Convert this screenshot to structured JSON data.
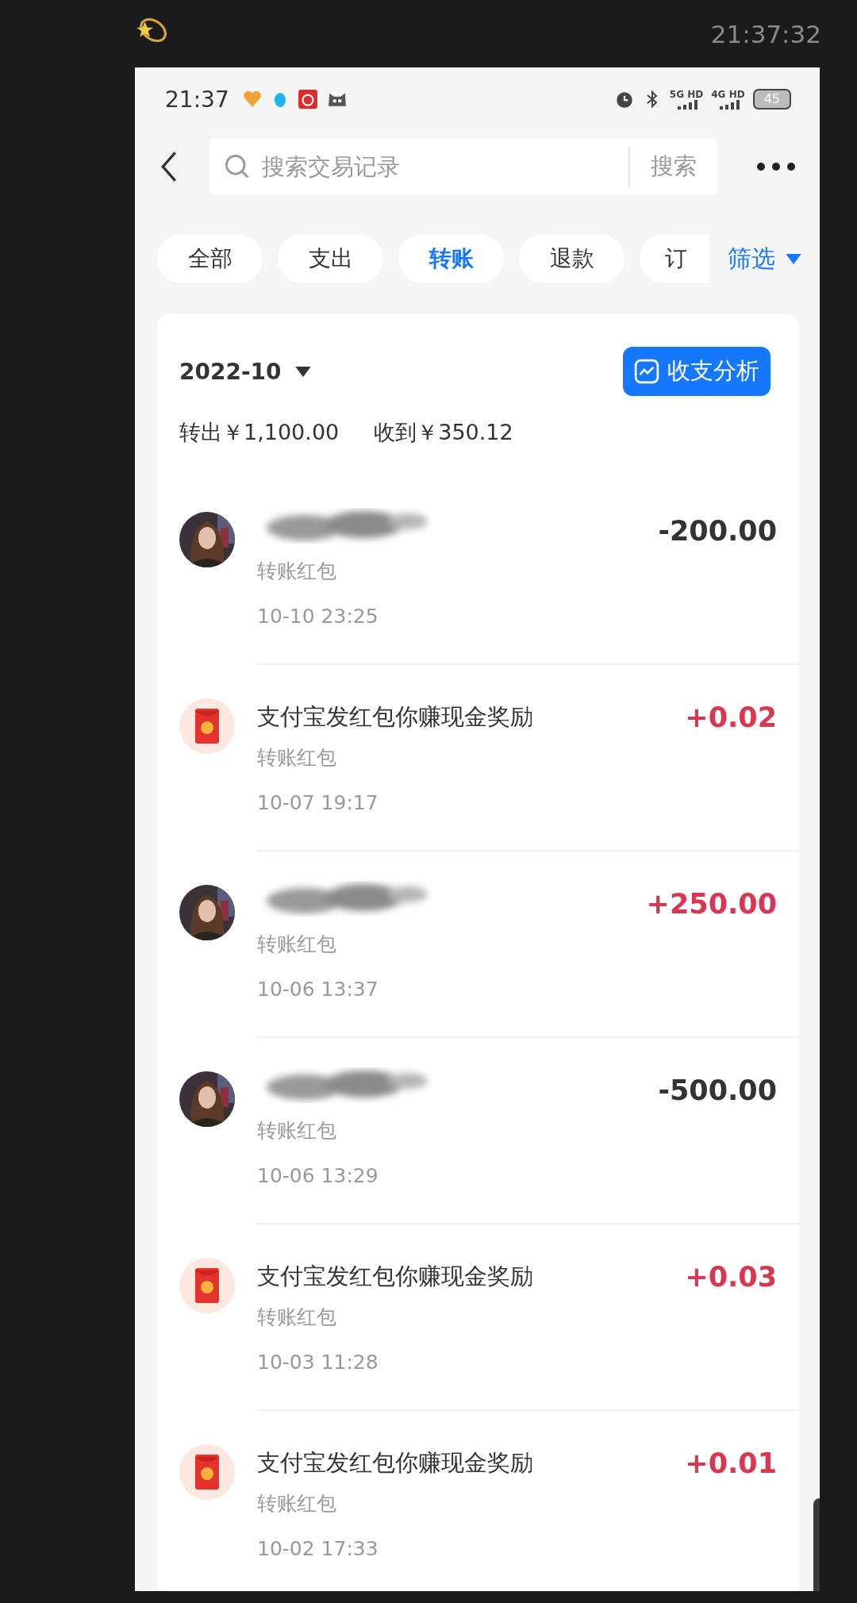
{
  "frame": {
    "clock": "21:37:32"
  },
  "status_bar": {
    "time": "21:37",
    "network_1": "5G HD",
    "network_2": "4G HD",
    "battery": "45"
  },
  "search": {
    "placeholder": "搜索交易记录",
    "button": "搜索"
  },
  "filters": [
    {
      "label": "全部",
      "selected": false
    },
    {
      "label": "支出",
      "selected": false
    },
    {
      "label": "转账",
      "selected": true
    },
    {
      "label": "退款",
      "selected": false
    },
    {
      "label": "订",
      "selected": false
    }
  ],
  "filter_button": "筛选",
  "month": "2022-10",
  "analysis_button": "收支分析",
  "summary": [
    "转出￥1,100.00",
    "收到￥350.12"
  ],
  "transactions": [
    {
      "kind": "person",
      "subtitle": "转账红包",
      "time": "10-10 23:25",
      "amount": "-200.00",
      "color": "#333333"
    },
    {
      "kind": "red_packet",
      "title": "支付宝发红包你赚现金奖励",
      "subtitle": "转账红包",
      "time": "10-07 19:17",
      "amount": "+0.02",
      "color": "#d9364f"
    },
    {
      "kind": "person",
      "subtitle": "转账红包",
      "time": "10-06 13:37",
      "amount": "+250.00",
      "color": "#d9364f"
    },
    {
      "kind": "person",
      "subtitle": "转账红包",
      "time": "10-06 13:29",
      "amount": "-500.00",
      "color": "#333333"
    },
    {
      "kind": "red_packet",
      "title": "支付宝发红包你赚现金奖励",
      "subtitle": "转账红包",
      "time": "10-03 11:28",
      "amount": "+0.03",
      "color": "#d9364f"
    },
    {
      "kind": "red_packet",
      "title": "支付宝发红包你赚现金奖励",
      "subtitle": "转账红包",
      "time": "10-02 17:33",
      "amount": "+0.01",
      "color": "#d9364f"
    }
  ]
}
